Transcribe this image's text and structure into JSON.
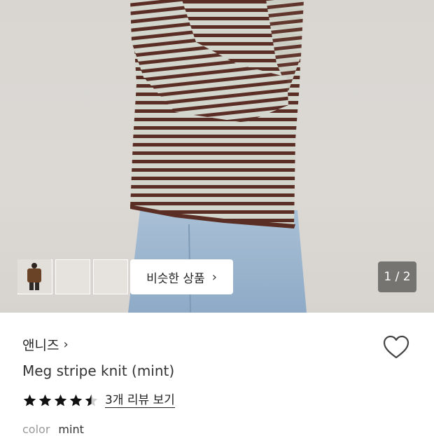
{
  "gallery": {
    "similar_button_label": "비슷한 상품",
    "counter": "1 / 2",
    "current_index": 1,
    "total_images": 2,
    "thumbnail_count": 3
  },
  "product": {
    "brand": "앤니즈",
    "title": "Meg stripe knit (mint)",
    "rating": 4.5,
    "review_link": "3개 리뷰 보기",
    "option_label": "color",
    "option_value": "mint"
  },
  "icons": {
    "brand_chevron": "chevron-right-icon",
    "similar_chevron": "chevron-right-icon",
    "wishlist": "heart-outline-icon",
    "rating": "star-icon"
  }
}
